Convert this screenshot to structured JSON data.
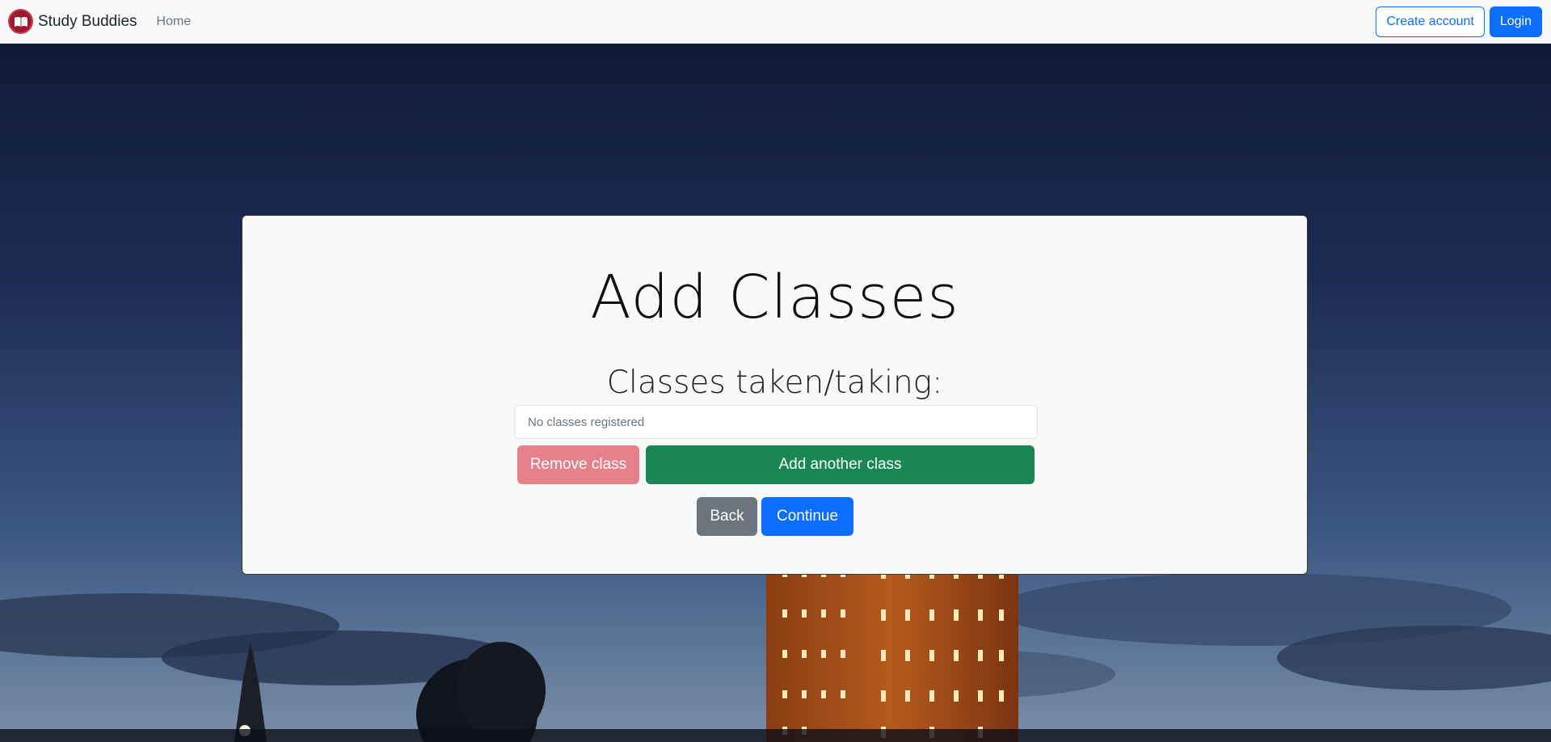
{
  "navbar": {
    "brand_name": "Study Buddies",
    "home_label": "Home",
    "create_account_label": "Create account",
    "login_label": "Login"
  },
  "card": {
    "title": "Add Classes",
    "subtitle": "Classes taken/taking:",
    "classes_placeholder": "No classes registered",
    "remove_class_label": "Remove class",
    "add_class_label": "Add another class",
    "back_label": "Back",
    "continue_label": "Continue"
  },
  "colors": {
    "primary": "#0d6efd",
    "success": "#198754",
    "danger_light": "#e4818b",
    "secondary": "#6c757d",
    "brand": "#9b1b2e"
  },
  "icons": {
    "brand_logo": "open-book-icon"
  }
}
